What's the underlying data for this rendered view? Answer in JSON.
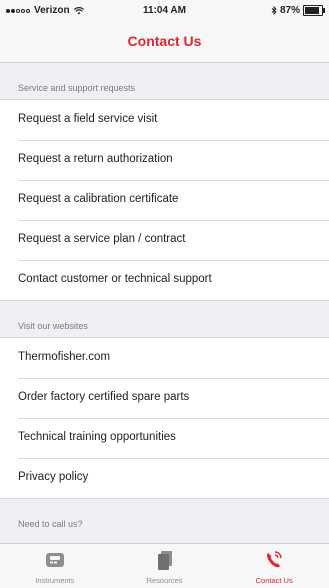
{
  "status_bar": {
    "carrier": "Verizon",
    "time": "11:04 AM",
    "battery": "87%",
    "battery_level": 0.87,
    "icons": [
      "signal-dots",
      "wifi-icon",
      "bluetooth-icon",
      "battery-icon"
    ]
  },
  "nav": {
    "title": "Contact Us"
  },
  "sections": [
    {
      "header": "Service and support requests",
      "items": [
        "Request a field service visit",
        "Request a return authorization",
        "Request a calibration certificate",
        "Request a service plan / contract",
        "Contact customer or technical support"
      ]
    },
    {
      "header": "Visit our websites",
      "items": [
        "Thermofisher.com",
        "Order factory certified spare parts",
        "Technical training opportunities",
        "Privacy policy"
      ]
    },
    {
      "header": "Need to call us?",
      "items": []
    }
  ],
  "tab_bar": {
    "tabs": [
      {
        "label": "Instruments",
        "icon": "instruments-icon",
        "active": false
      },
      {
        "label": "Resources",
        "icon": "resources-icon",
        "active": false
      },
      {
        "label": "Contact Us",
        "icon": "phone-icon",
        "active": true
      }
    ]
  },
  "colors": {
    "accent": "#e0262e",
    "inactive": "#8e8e93",
    "background": "#efeff4"
  }
}
